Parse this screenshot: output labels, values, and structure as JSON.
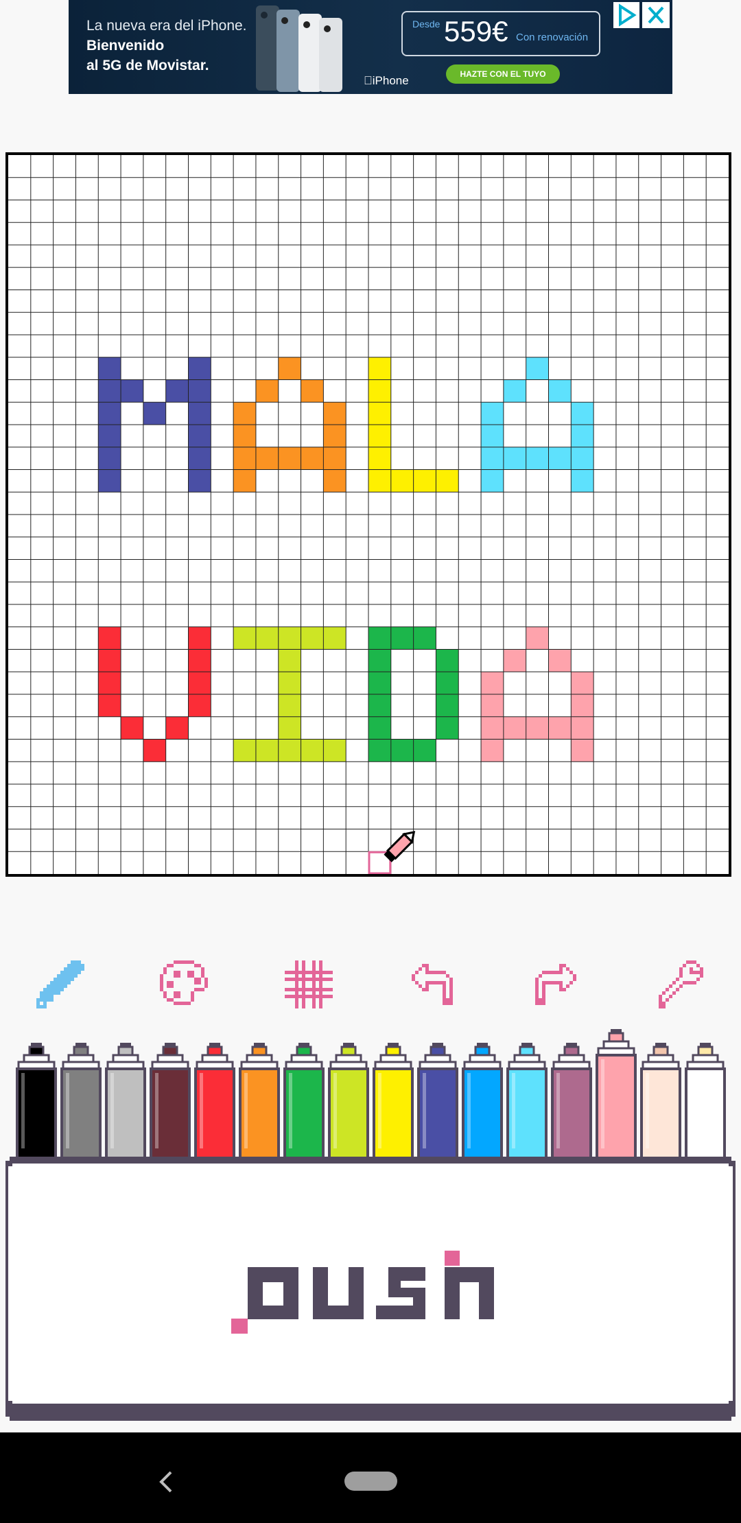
{
  "ad": {
    "line1": "La nueva era del iPhone.",
    "line2": "Bienvenido",
    "line3": "al 5G de Movistar.",
    "desde": "Desde",
    "price": "559€",
    "renovacion": "Con renovación",
    "cta": "HAZTE CON EL TUYO",
    "brand": "iPhone"
  },
  "grid": {
    "cols": 32,
    "rows": 32
  },
  "art": {
    "colors": {
      "navy": "#4a4fa5",
      "orange": "#fb9322",
      "yellow": "#fef000",
      "cyan": "#5ee1fd",
      "red": "#fb2d37",
      "lime": "#cde525",
      "green": "#1cb64b",
      "pink": "#fea3ac"
    },
    "words": [
      "MALA",
      "VIDA"
    ]
  },
  "toolbar": {
    "accent": "#e36598",
    "active": "#6ec1ef",
    "tools": [
      "pencil-icon",
      "palette-icon",
      "grid-icon",
      "undo-icon",
      "redo-icon",
      "wrench-icon"
    ]
  },
  "palette": [
    "#000000",
    "#808080",
    "#bfbfbf",
    "#6a2e38",
    "#fb2d37",
    "#fb9322",
    "#1cb64b",
    "#cde525",
    "#fef000",
    "#4a4fa5",
    "#03a7ff",
    "#5ee1fd",
    "#ae6a8e",
    "#fea3ac",
    "#fee6d8",
    "#ffffff"
  ],
  "selected_color_index": 13,
  "push": {
    "label": "push"
  }
}
